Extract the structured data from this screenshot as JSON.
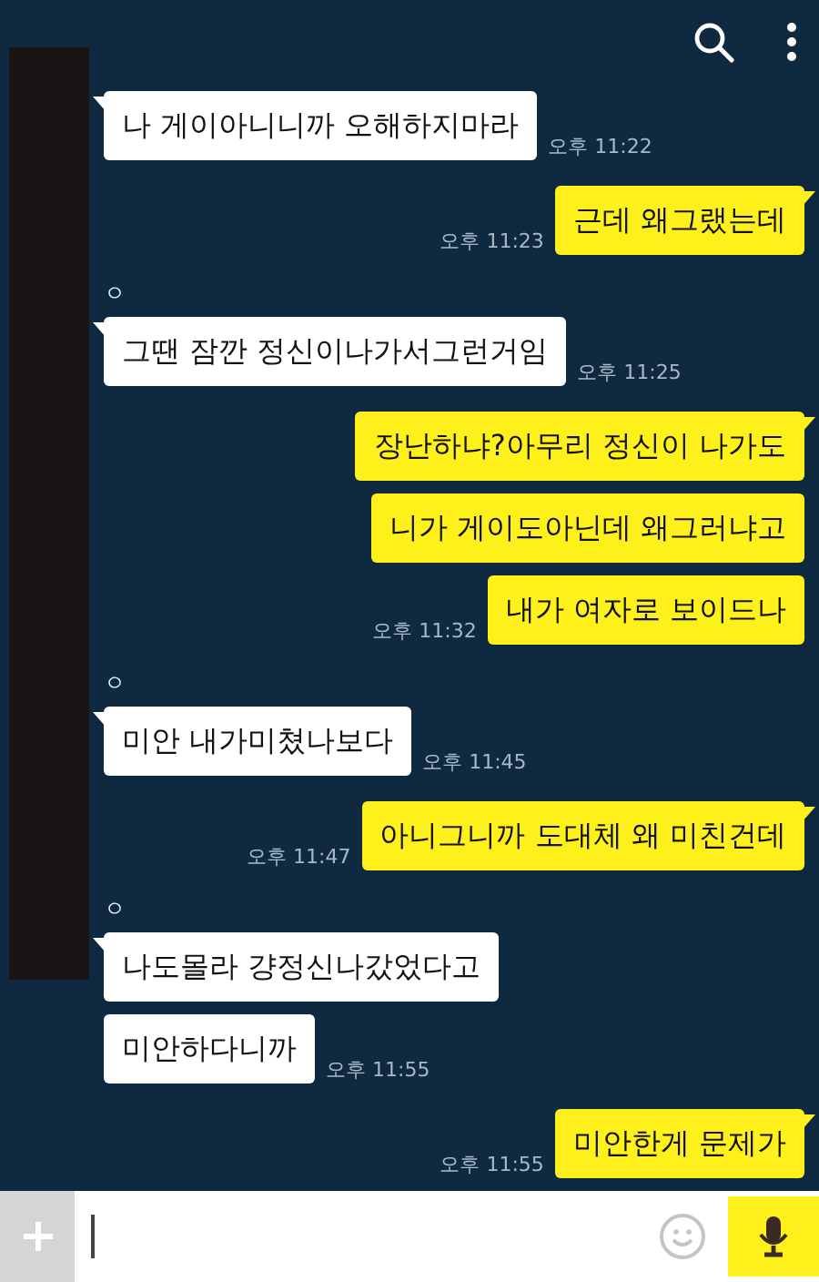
{
  "messages": [
    {
      "kind": "received",
      "bubbles": [
        {
          "text": "나 게이아니니까 오해하지마라",
          "time": "오후 11:22"
        }
      ]
    },
    {
      "kind": "sent",
      "bubbles": [
        {
          "text": "근데 왜그랬는데",
          "time": "오후 11:23"
        }
      ]
    },
    {
      "kind": "received",
      "sender": "ㅇ",
      "bubbles": [
        {
          "text": "그땐 잠깐 정신이나가서그런거임",
          "time": "오후 11:25"
        }
      ]
    },
    {
      "kind": "sent",
      "bubbles": [
        {
          "text": "장난하냐?아무리 정신이 나가도"
        },
        {
          "text": "니가 게이도아닌데 왜그러냐고"
        },
        {
          "text": "내가 여자로 보이드나",
          "time": "오후 11:32"
        }
      ]
    },
    {
      "kind": "received",
      "sender": "ㅇ",
      "bubbles": [
        {
          "text": "미안 내가미쳤나보다",
          "time": "오후 11:45"
        }
      ]
    },
    {
      "kind": "sent",
      "bubbles": [
        {
          "text": "아니그니까 도대체 왜 미친건데",
          "time": "오후 11:47"
        }
      ]
    },
    {
      "kind": "received",
      "sender": "ㅇ",
      "bubbles": [
        {
          "text": "나도몰라 걍정신나갔었다고"
        },
        {
          "text": "미안하다니까",
          "time": "오후 11:55"
        }
      ]
    },
    {
      "kind": "sent",
      "bubbles": [
        {
          "text": "미안한게 문제가",
          "time": "오후 11:55"
        }
      ]
    }
  ],
  "composer": {
    "redacted_profile": true
  }
}
